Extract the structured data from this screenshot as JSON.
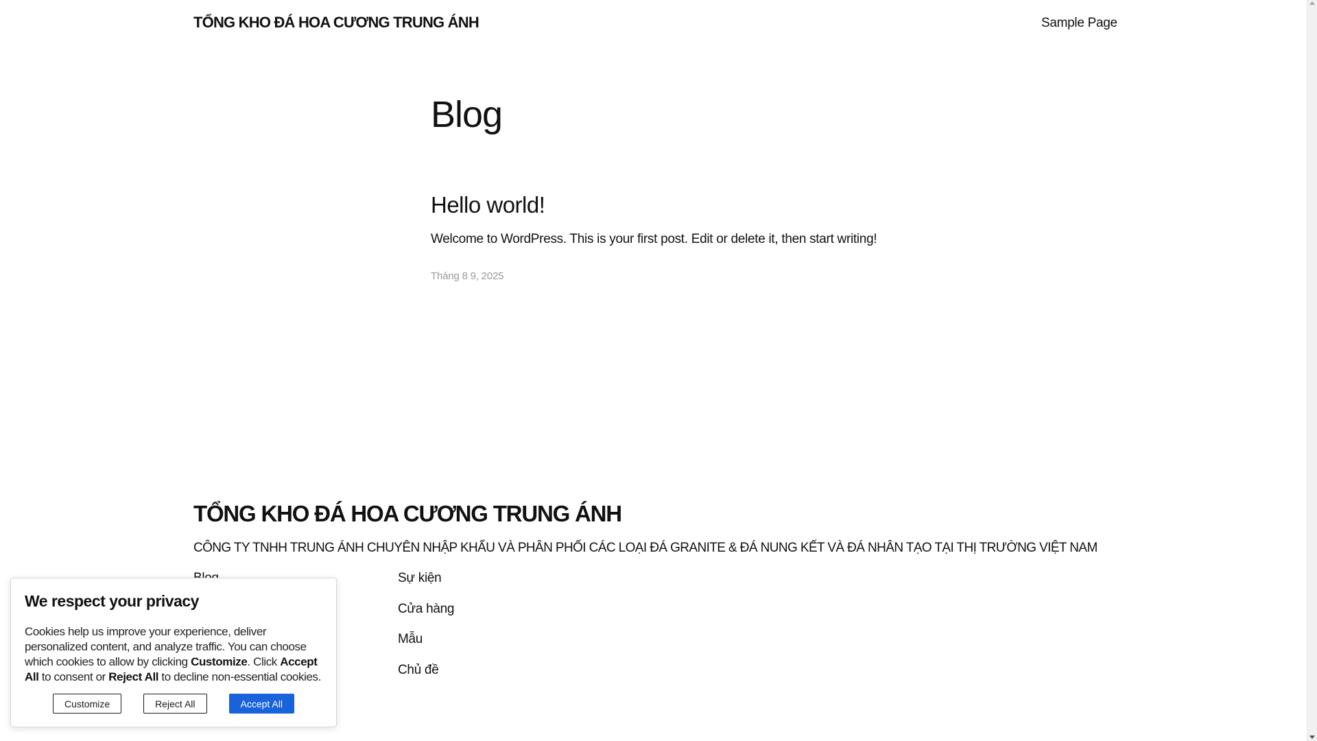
{
  "header": {
    "site_title": "TỔNG KHO ĐÁ HOA CƯƠNG TRUNG ÁNH",
    "nav": [
      "Sample Page"
    ]
  },
  "main": {
    "page_title": "Blog",
    "post": {
      "title": "Hello world!",
      "excerpt": "Welcome to WordPress. This is your first post. Edit or delete it, then start writing!",
      "date": "Tháng 8 9, 2025"
    }
  },
  "footer": {
    "title": "TỔNG KHO ĐÁ HOA CƯƠNG TRUNG ÁNH",
    "tagline": "CÔNG TY TNHH TRUNG ÁNH CHUYÊN NHẬP KHẨU VÀ PHÂN PHỐI CÁC LOẠI ĐÁ GRANITE & ĐÁ NUNG KẾT VÀ ĐÁ NHÂN TẠO TẠI THỊ TRƯỜNG VIỆT NAM",
    "col1": [
      "Blog"
    ],
    "col2": [
      "Sự kiện",
      "Cửa hàng",
      "Mẫu",
      "Chủ đề"
    ]
  },
  "cookie": {
    "heading": "We respect your privacy",
    "text_1": "Cookies help us improve your experience, deliver personalized content, and analyze traffic. You can choose which cookies to allow by clicking ",
    "bold_1": "Customize",
    "text_2": ". Click ",
    "bold_2": "Accept All",
    "text_3": " to consent or ",
    "bold_3": "Reject All",
    "text_4": " to decline non-essential cookies.",
    "buttons": {
      "customize": "Customize",
      "reject": "Reject All",
      "accept": "Accept All"
    }
  },
  "colors": {
    "accent": "#1863dc",
    "text": "#111111",
    "muted": "#9a9a9a"
  }
}
